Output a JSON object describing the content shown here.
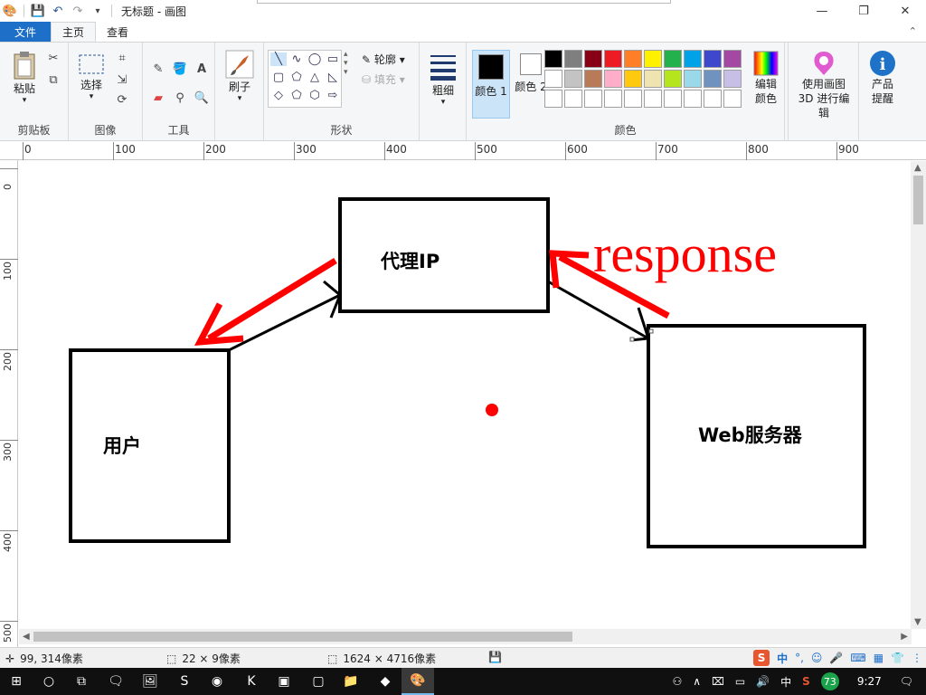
{
  "window": {
    "title": "无标题 - 画图",
    "buttons": [
      "—",
      "❐",
      "✕"
    ]
  },
  "tabs": {
    "file": "文件",
    "home": "主页",
    "view": "查看"
  },
  "ribbon": {
    "clipboard": {
      "paste": "粘贴",
      "group": "剪贴板"
    },
    "image": {
      "select": "选择",
      "group": "图像"
    },
    "tools": {
      "group": "工具"
    },
    "brushes": {
      "label": "刷子"
    },
    "shapes": {
      "outline": "轮廓",
      "fill": "填充",
      "group": "形状"
    },
    "size": {
      "label": "粗细"
    },
    "color1": {
      "label": "颜色 1",
      "value": "#000000"
    },
    "color2": {
      "label": "颜色 2",
      "value": "#ffffff"
    },
    "colors": {
      "group": "颜色",
      "edit": "编辑颜色"
    },
    "paint3d": {
      "label": "使用画图 3D 进行编辑"
    },
    "product": {
      "label": "产品提醒"
    }
  },
  "palette": [
    "#000000",
    "#7f7f7f",
    "#880015",
    "#ed1c24",
    "#ff7f27",
    "#fff200",
    "#22b14c",
    "#00a2e8",
    "#3f48cc",
    "#a349a4",
    "#ffffff",
    "#c3c3c3",
    "#b97a57",
    "#ffaec9",
    "#ffc90e",
    "#efe4b0",
    "#b5e61d",
    "#99d9ea",
    "#7092be",
    "#c8bfe7",
    "#ffffff",
    "#ffffff",
    "#ffffff",
    "#ffffff",
    "#ffffff",
    "#ffffff",
    "#ffffff",
    "#ffffff",
    "#ffffff",
    "#ffffff"
  ],
  "ruler": {
    "h": [
      "0",
      "100",
      "200",
      "300",
      "400",
      "500",
      "600",
      "700",
      "800",
      "900"
    ],
    "v": [
      "0",
      "100",
      "200",
      "300",
      "400",
      "500"
    ]
  },
  "drawing": {
    "proxy_label": "代理IP",
    "user_label": "用户",
    "server_label": "Web服务器",
    "response_label": "response",
    "arrow_color": "#ff0000",
    "box_color": "#000000"
  },
  "status": {
    "cursor": "99, 314像素",
    "selection": "22 × 9像素",
    "image_size": "1624 × 4716像素"
  },
  "ime": {
    "lang": "中"
  },
  "taskbar": {
    "ime_lang": "中",
    "battery": "73",
    "time": "9:27"
  }
}
